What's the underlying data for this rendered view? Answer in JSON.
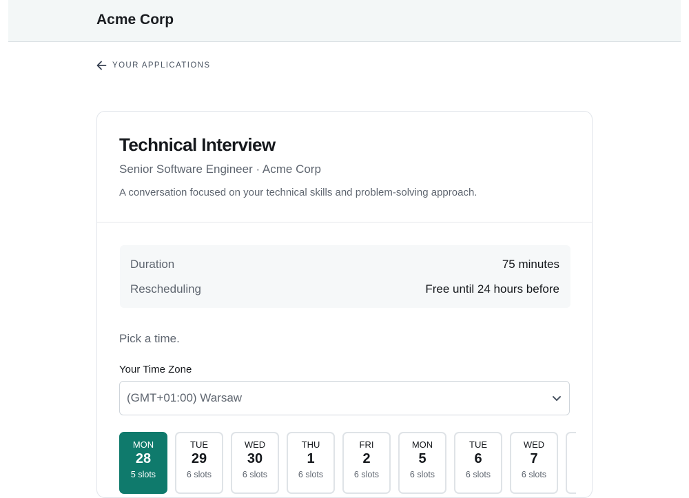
{
  "header": {
    "brand": "Acme Corp"
  },
  "nav": {
    "back_label": "YOUR APPLICATIONS"
  },
  "interview": {
    "title": "Technical Interview",
    "subtitle": "Senior Software Engineer · Acme Corp",
    "description": "A conversation focused on your technical skills and problem-solving approach."
  },
  "details": {
    "duration_label": "Duration",
    "duration_value": "75 minutes",
    "rescheduling_label": "Rescheduling",
    "rescheduling_value": "Free until 24 hours before"
  },
  "scheduler": {
    "prompt": "Pick a time.",
    "timezone_label": "Your Time Zone",
    "timezone_value": "(GMT+01:00) Warsaw",
    "days": [
      {
        "dow": "MON",
        "date": "28",
        "slots": "5 slots",
        "selected": true
      },
      {
        "dow": "TUE",
        "date": "29",
        "slots": "6 slots"
      },
      {
        "dow": "WED",
        "date": "30",
        "slots": "6 slots"
      },
      {
        "dow": "THU",
        "date": "1",
        "slots": "6 slots"
      },
      {
        "dow": "FRI",
        "date": "2",
        "slots": "6 slots"
      },
      {
        "dow": "MON",
        "date": "5",
        "slots": "6 slots"
      },
      {
        "dow": "TUE",
        "date": "6",
        "slots": "6 slots"
      },
      {
        "dow": "WED",
        "date": "7",
        "slots": "6 slots"
      },
      {
        "dow": "",
        "date": "",
        "slots": ""
      }
    ]
  },
  "colors": {
    "accent": "#0f7a6c",
    "header_bg": "#f3f7f7"
  },
  "icons": {
    "back": "arrow-left-icon",
    "select": "chevron-down-icon"
  }
}
